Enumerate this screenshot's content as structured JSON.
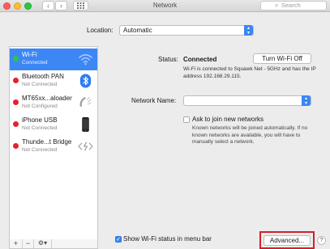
{
  "window": {
    "title": "Network",
    "search_placeholder": "Search"
  },
  "location": {
    "label": "Location:",
    "value": "Automatic"
  },
  "services": [
    {
      "name": "Wi-Fi",
      "status": "Connected",
      "dot": "green",
      "icon": "wifi-icon",
      "selected": true
    },
    {
      "name": "Bluetooth PAN",
      "status": "Not Connected",
      "dot": "red",
      "icon": "bluetooth-icon"
    },
    {
      "name": "MT65xx...aloader",
      "status": "Not Configured",
      "dot": "red",
      "icon": "phone-handset-icon"
    },
    {
      "name": "iPhone USB",
      "status": "Not Connected",
      "dot": "red",
      "icon": "iphone-icon"
    },
    {
      "name": "Thunde...t Bridge",
      "status": "Not Connected",
      "dot": "red",
      "icon": "thunderbolt-bridge-icon"
    }
  ],
  "sidebar_footer": {
    "add": "+",
    "remove": "−",
    "gear": "⚙▾"
  },
  "detail": {
    "status_label": "Status:",
    "status_value": "Connected",
    "turn_off_button": "Turn Wi-Fi Off",
    "status_description": "Wi-Fi is connected to Squawk Net - 5GHz and has the IP address 192.168.29.115.",
    "network_name_label": "Network Name:",
    "network_name_value": "",
    "ask_join_label": "Ask to join new networks",
    "ask_join_checked": false,
    "ask_join_description": "Known networks will be joined automatically. If no known networks are available, you will have to manually select a network."
  },
  "footer": {
    "show_wifi_label": "Show Wi-Fi status in menu bar",
    "show_wifi_checked": true,
    "advanced_button": "Advanced...",
    "help_button": "?"
  },
  "colors": {
    "accent": "#3d87f5",
    "status_connected": "#2cc64a",
    "status_disconnected": "#e5222a",
    "highlight_box": "#d0212a"
  }
}
